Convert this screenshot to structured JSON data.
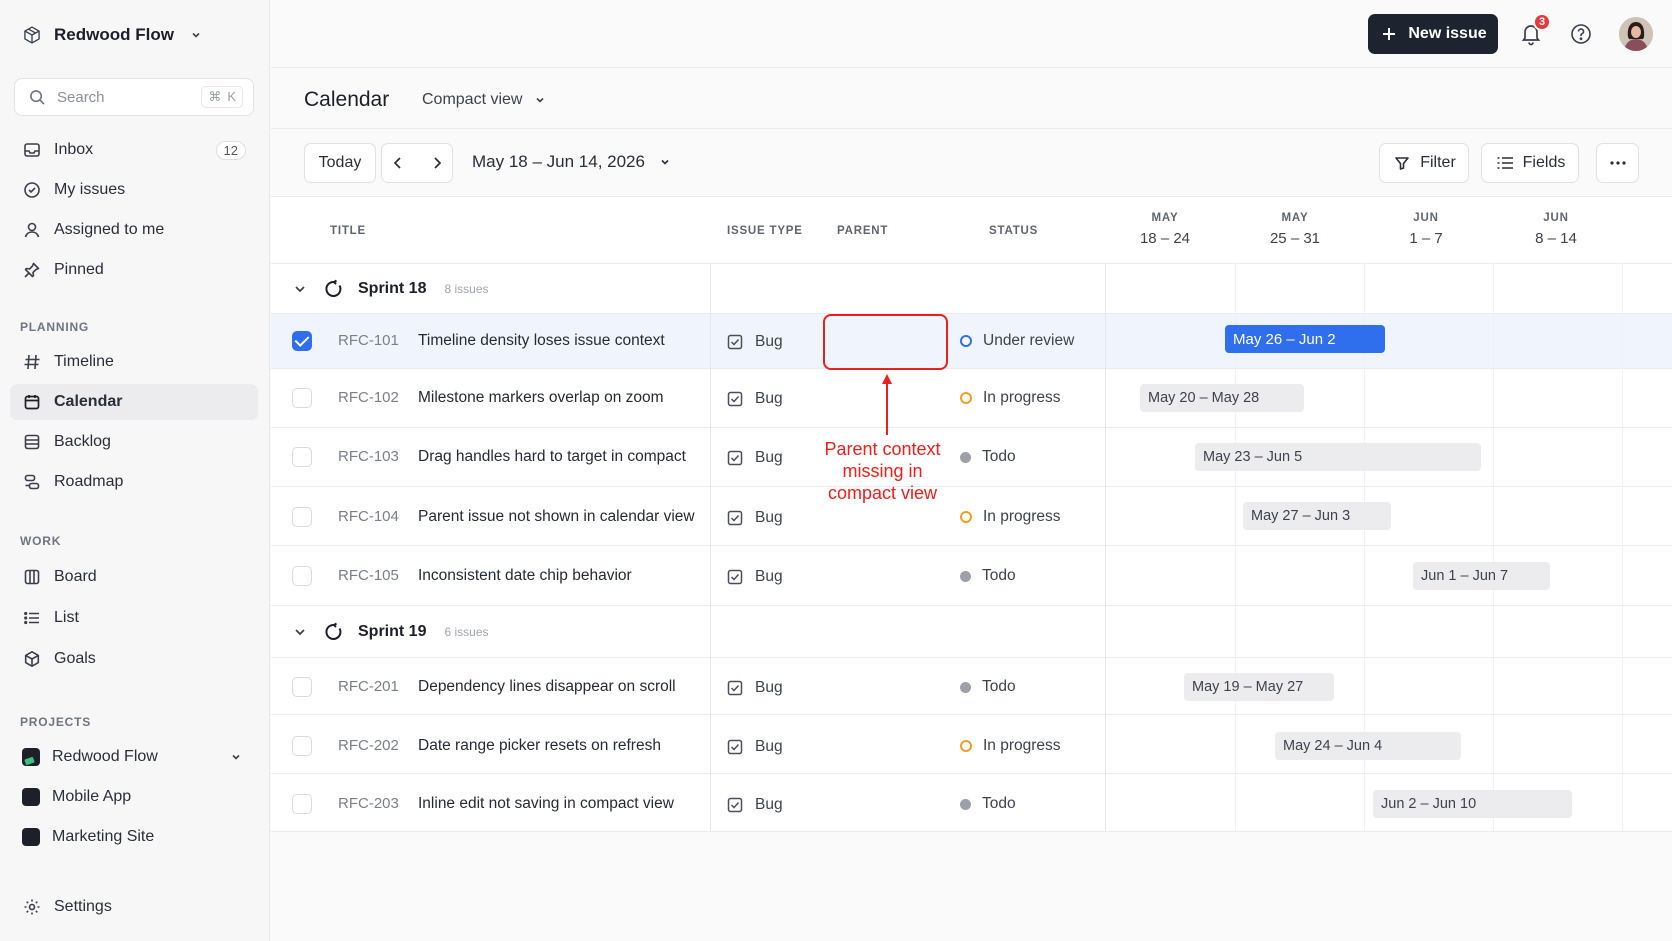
{
  "workspace": {
    "name": "Redwood Flow",
    "icon": "cube-icon"
  },
  "search": {
    "placeholder": "Search",
    "shortcut_cmd": "⌘",
    "shortcut_key": "K"
  },
  "nav": [
    {
      "label": "Inbox",
      "icon": "inbox-icon",
      "count": "12"
    },
    {
      "label": "My issues",
      "icon": "my-issues-icon"
    },
    {
      "label": "Assigned to me",
      "icon": "user-icon"
    },
    {
      "label": "Pinned",
      "icon": "pin-icon"
    }
  ],
  "planning": {
    "heading": "PLANNING",
    "items": [
      {
        "label": "Timeline",
        "icon": "hash-icon"
      },
      {
        "label": "Calendar",
        "icon": "calendar-icon",
        "active": true
      },
      {
        "label": "Backlog",
        "icon": "backlog-icon"
      },
      {
        "label": "Roadmap",
        "icon": "roadmap-icon"
      }
    ]
  },
  "work": {
    "heading": "WORK",
    "items": [
      {
        "label": "Board",
        "icon": "board-icon"
      },
      {
        "label": "List",
        "icon": "list-icon"
      },
      {
        "label": "Goals",
        "icon": "goals-icon"
      }
    ]
  },
  "projects": {
    "heading": "PROJECTS",
    "items": [
      {
        "label": "Redwood Flow"
      },
      {
        "label": "Mobile App"
      },
      {
        "label": "Marketing Site"
      }
    ]
  },
  "settings": {
    "label": "Settings"
  },
  "topbar": {
    "new_issue_label": "New issue",
    "notification_count": "3"
  },
  "header": {
    "title": "Calendar",
    "view_label": "Compact view"
  },
  "toolbar": {
    "today_label": "Today",
    "date_range": "May 18 – Jun 14, 2026",
    "filter_label": "Filter",
    "fields_label": "Fields"
  },
  "table": {
    "columns": {
      "title": "TITLE",
      "issue_type": "ISSUE TYPE",
      "parent": "PARENT",
      "status": "STATUS"
    },
    "weeks": [
      {
        "month": "MAY",
        "range": "18 – 24"
      },
      {
        "month": "MAY",
        "range": "25 – 31"
      },
      {
        "month": "JUN",
        "range": "1 – 7"
      },
      {
        "month": "JUN",
        "range": "8 – 14"
      }
    ],
    "groups": [
      {
        "name": "Sprint 18",
        "count": "8 issues",
        "rows": [
          {
            "id": "RFC-101",
            "title": "Timeline density loses issue context",
            "type": "Bug",
            "status": "Under review",
            "status_kind": "review",
            "chip": "May 26 – Jun 2",
            "selected": true
          },
          {
            "id": "RFC-102",
            "title": "Milestone markers overlap on zoom",
            "type": "Bug",
            "status": "In progress",
            "status_kind": "progress",
            "chip": "May 20 – May 28"
          },
          {
            "id": "RFC-103",
            "title": "Drag handles hard to target in compact",
            "type": "Bug",
            "status": "Todo",
            "status_kind": "todo",
            "chip": "May 23 – Jun 5"
          },
          {
            "id": "RFC-104",
            "title": "Parent issue not shown in calendar view",
            "type": "Bug",
            "status": "In progress",
            "status_kind": "progress",
            "chip": "May 27 – Jun 3"
          },
          {
            "id": "RFC-105",
            "title": "Inconsistent date chip behavior",
            "type": "Bug",
            "status": "Todo",
            "status_kind": "todo",
            "chip": "Jun 1 – Jun 7"
          }
        ]
      },
      {
        "name": "Sprint 19",
        "count": "6 issues",
        "rows": [
          {
            "id": "RFC-201",
            "title": "Dependency lines disappear on scroll",
            "type": "Bug",
            "status": "Todo",
            "status_kind": "todo",
            "chip": "May 19 – May 27"
          },
          {
            "id": "RFC-202",
            "title": "Date range picker resets on refresh",
            "type": "Bug",
            "status": "In progress",
            "status_kind": "progress",
            "chip": "May 24 – Jun 4"
          },
          {
            "id": "RFC-203",
            "title": "Inline edit not saving in compact view",
            "type": "Bug",
            "status": "Todo",
            "status_kind": "todo",
            "chip": "Jun 2 – Jun 10"
          }
        ]
      }
    ]
  },
  "annotation": {
    "line1": "Parent context",
    "line2": "missing in",
    "line3": "compact view"
  },
  "colors": {
    "accent": "#2f6fed",
    "annotation": "#e8201e",
    "in_progress": "#f0a020",
    "todo": "#9ca0a8"
  }
}
